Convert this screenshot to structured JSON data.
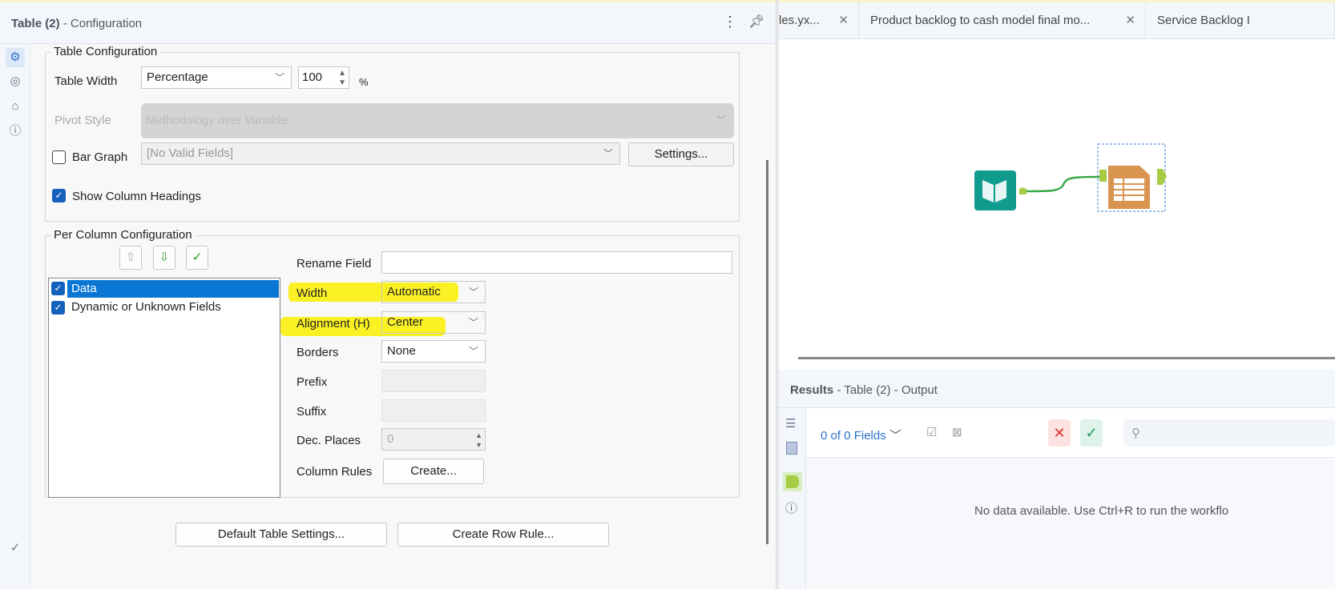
{
  "left_panel": {
    "title_bold": "Table (2)",
    "title_rest": "- Configuration",
    "menu_icon": "more-vertical-icon",
    "pin_icon": "pin-icon"
  },
  "rail": [
    "gear-icon",
    "connection-icon",
    "tag-icon",
    "help-icon",
    "check-circle-icon"
  ],
  "table_config": {
    "group_label": "Table Configuration",
    "table_width_label": "Table Width",
    "table_width_value": "Percentage",
    "table_width_number": "100",
    "percent": "%",
    "pivot_style_label": "Pivot Style",
    "pivot_style_value": "Methodology over Variable",
    "bar_graph_label": "Bar Graph",
    "bar_graph_checked": false,
    "bar_graph_value": "[No Valid Fields]",
    "settings_button": "Settings...",
    "show_headings_label": "Show Column Headings",
    "show_headings_checked": true
  },
  "per_column": {
    "group_label": "Per Column Configuration",
    "fields": [
      {
        "label": "Data",
        "checked": true,
        "selected": true
      },
      {
        "label": "Dynamic or Unknown Fields",
        "checked": true,
        "selected": false
      }
    ],
    "rename_label": "Rename Field",
    "rename_value": "",
    "width_label": "Width",
    "width_value": "Automatic",
    "alignment_label": "Alignment (H)",
    "alignment_value": "Center",
    "borders_label": "Borders",
    "borders_value": "None",
    "prefix_label": "Prefix",
    "suffix_label": "Suffix",
    "dec_label": "Dec. Places",
    "dec_value": "0",
    "rules_label": "Column Rules",
    "create_button": "Create..."
  },
  "bottom_buttons": {
    "default": "Default Table Settings...",
    "row_rule": "Create Row Rule..."
  },
  "tabs": [
    {
      "label": "les.yx..."
    },
    {
      "label": "Product backlog to cash model final mo..."
    },
    {
      "label": "Service Backlog I"
    }
  ],
  "results": {
    "title_bold": "Results",
    "title_rest": "- Table (2) - Output",
    "fields": "0 of 0 Fields",
    "empty": "No data available. Use Ctrl+R to run the workflo"
  },
  "colors": {
    "accent": "#1560bd",
    "input_tool": "#0f9b8e",
    "table_tool": "#d9944f",
    "connector": "#a6cc44",
    "highlight": "#f5ea00"
  }
}
